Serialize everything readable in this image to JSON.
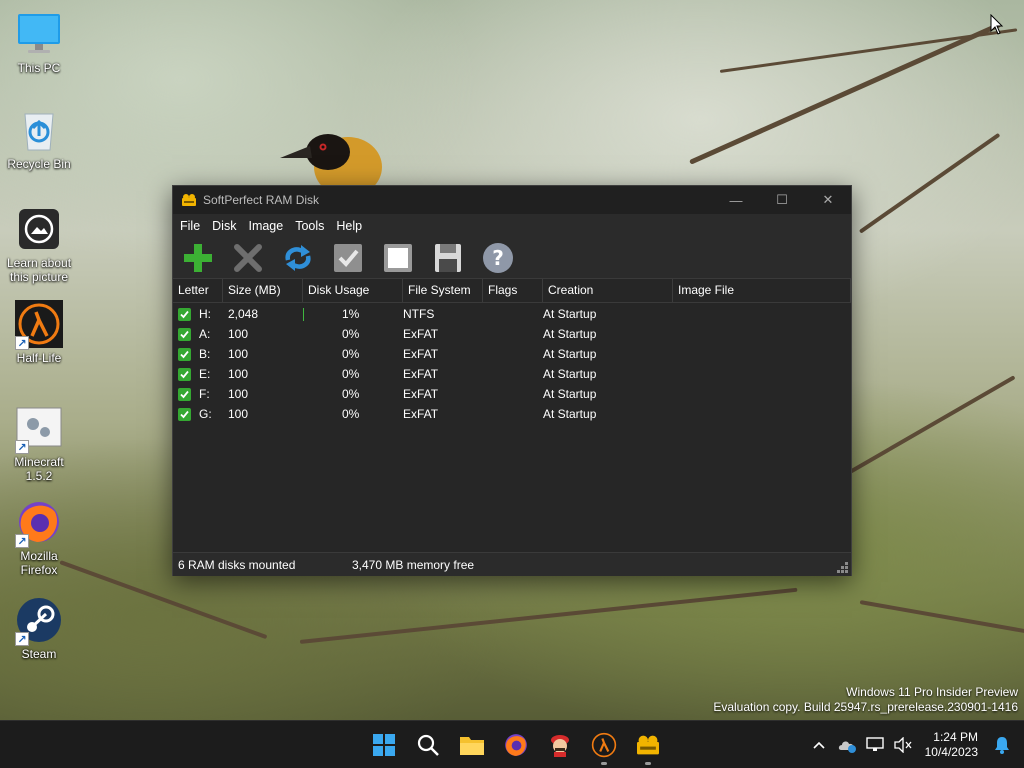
{
  "desktop": {
    "icons": [
      {
        "label": "This PC",
        "icon": "monitor-icon"
      },
      {
        "label": "Recycle Bin",
        "icon": "recycle-bin-icon"
      },
      {
        "label": "Learn about this picture",
        "icon": "camera-icon"
      },
      {
        "label": "Half-Life",
        "icon": "half-life-icon"
      },
      {
        "label": "Minecraft 1.5.2",
        "icon": "minecraft-icon"
      },
      {
        "label": "Mozilla Firefox",
        "icon": "firefox-icon"
      },
      {
        "label": "Steam",
        "icon": "steam-icon"
      }
    ],
    "watermark": {
      "line1": "Windows 11 Pro Insider Preview",
      "line2": "Evaluation copy. Build 25947.rs_prerelease.230901-1416"
    }
  },
  "window": {
    "title": "SoftPerfect RAM Disk",
    "controls": {
      "minimize": "—",
      "maximize": "☐",
      "close": "✕"
    },
    "menu": [
      "File",
      "Disk",
      "Image",
      "Tools",
      "Help"
    ],
    "toolbar": [
      {
        "name": "add-disk",
        "icon": "plus-icon",
        "color": "#3cb034"
      },
      {
        "name": "remove-disk",
        "icon": "x-icon",
        "color": "#6e6e6e"
      },
      {
        "name": "refresh",
        "icon": "refresh-icon",
        "color": "#2f8fd8"
      },
      {
        "name": "mount",
        "icon": "checkmark-icon",
        "color": "#9a9a9a"
      },
      {
        "name": "unmount",
        "icon": "stop-icon",
        "color": "#e0e0e0"
      },
      {
        "name": "save-image",
        "icon": "floppy-icon",
        "color": "#dcdcdc"
      },
      {
        "name": "help",
        "icon": "help-icon",
        "color": "#8f98a8"
      }
    ],
    "columns": [
      "Letter",
      "Size (MB)",
      "Disk Usage",
      "File System",
      "Flags",
      "Creation",
      "Image File"
    ],
    "rows": [
      {
        "letter": "H:",
        "size": "2,048",
        "usage": "1%",
        "fs": "NTFS",
        "flags": "",
        "creation": "At Startup",
        "image": "",
        "usage_fraction": 0.01
      },
      {
        "letter": "A:",
        "size": "100",
        "usage": "0%",
        "fs": "ExFAT",
        "flags": "",
        "creation": "At Startup",
        "image": "",
        "usage_fraction": 0
      },
      {
        "letter": "B:",
        "size": "100",
        "usage": "0%",
        "fs": "ExFAT",
        "flags": "",
        "creation": "At Startup",
        "image": "",
        "usage_fraction": 0
      },
      {
        "letter": "E:",
        "size": "100",
        "usage": "0%",
        "fs": "ExFAT",
        "flags": "",
        "creation": "At Startup",
        "image": "",
        "usage_fraction": 0
      },
      {
        "letter": "F:",
        "size": "100",
        "usage": "0%",
        "fs": "ExFAT",
        "flags": "",
        "creation": "At Startup",
        "image": "",
        "usage_fraction": 0
      },
      {
        "letter": "G:",
        "size": "100",
        "usage": "0%",
        "fs": "ExFAT",
        "flags": "",
        "creation": "At Startup",
        "image": "",
        "usage_fraction": 0
      }
    ],
    "status": {
      "mounted": "6 RAM disks mounted",
      "memory": "3,470 MB memory free"
    }
  },
  "taskbar": {
    "apps": [
      "start-icon",
      "search-icon",
      "file-explorer-icon",
      "firefox-icon",
      "mario-icon",
      "half-life-icon",
      "ramdisk-icon"
    ],
    "clock": {
      "time": "1:24 PM",
      "date": "10/4/2023"
    }
  }
}
